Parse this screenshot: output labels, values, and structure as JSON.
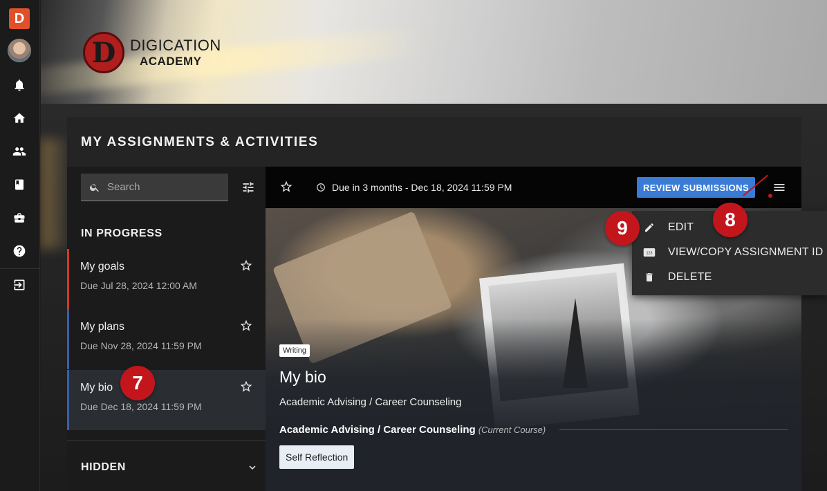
{
  "rail": {
    "logo_letter": "D",
    "icons": [
      "notifications-icon",
      "home-icon",
      "people-icon",
      "book-icon",
      "briefcase-icon",
      "help-icon",
      "sign-in-icon"
    ]
  },
  "brand": {
    "line1": "DIGICATION",
    "line2": "ACADEMY",
    "mark_letter": "D"
  },
  "page": {
    "title": "MY ASSIGNMENTS & ACTIVITIES"
  },
  "search": {
    "placeholder": "Search"
  },
  "list": {
    "in_progress_label": "IN PROGRESS",
    "hidden_label": "HIDDEN",
    "items": [
      {
        "title": "My goals",
        "due": "Due Jul 28, 2024 12:00 AM",
        "accent": "#d03a2a"
      },
      {
        "title": "My plans",
        "due": "Due Nov 28, 2024 11:59 PM",
        "accent": "#3a5fa8"
      },
      {
        "title": "My bio",
        "due": "Due Dec 18, 2024 11:59 PM",
        "accent": "#3a5fa8"
      }
    ]
  },
  "detail": {
    "due": "Due in 3 months - Dec 18, 2024 11:59 PM",
    "review_button": "REVIEW SUBMISSIONS",
    "category": "Writing",
    "title": "My bio",
    "subtitle": "Academic Advising / Career Counseling",
    "course": "Academic Advising / Career Counseling",
    "course_note": "(Current Course)",
    "tag": "Self Reflection"
  },
  "menu": {
    "items": [
      {
        "label": "EDIT",
        "icon": "pencil-icon"
      },
      {
        "label": "VIEW/COPY ASSIGNMENT ID",
        "icon": "numbers-icon"
      },
      {
        "label": "DELETE",
        "icon": "trash-icon"
      }
    ]
  },
  "markers": [
    "7",
    "8",
    "9"
  ],
  "colors": {
    "accent_blue": "#3a7bd5",
    "marker_red": "#c3161c",
    "logo_orange": "#e0502a"
  }
}
